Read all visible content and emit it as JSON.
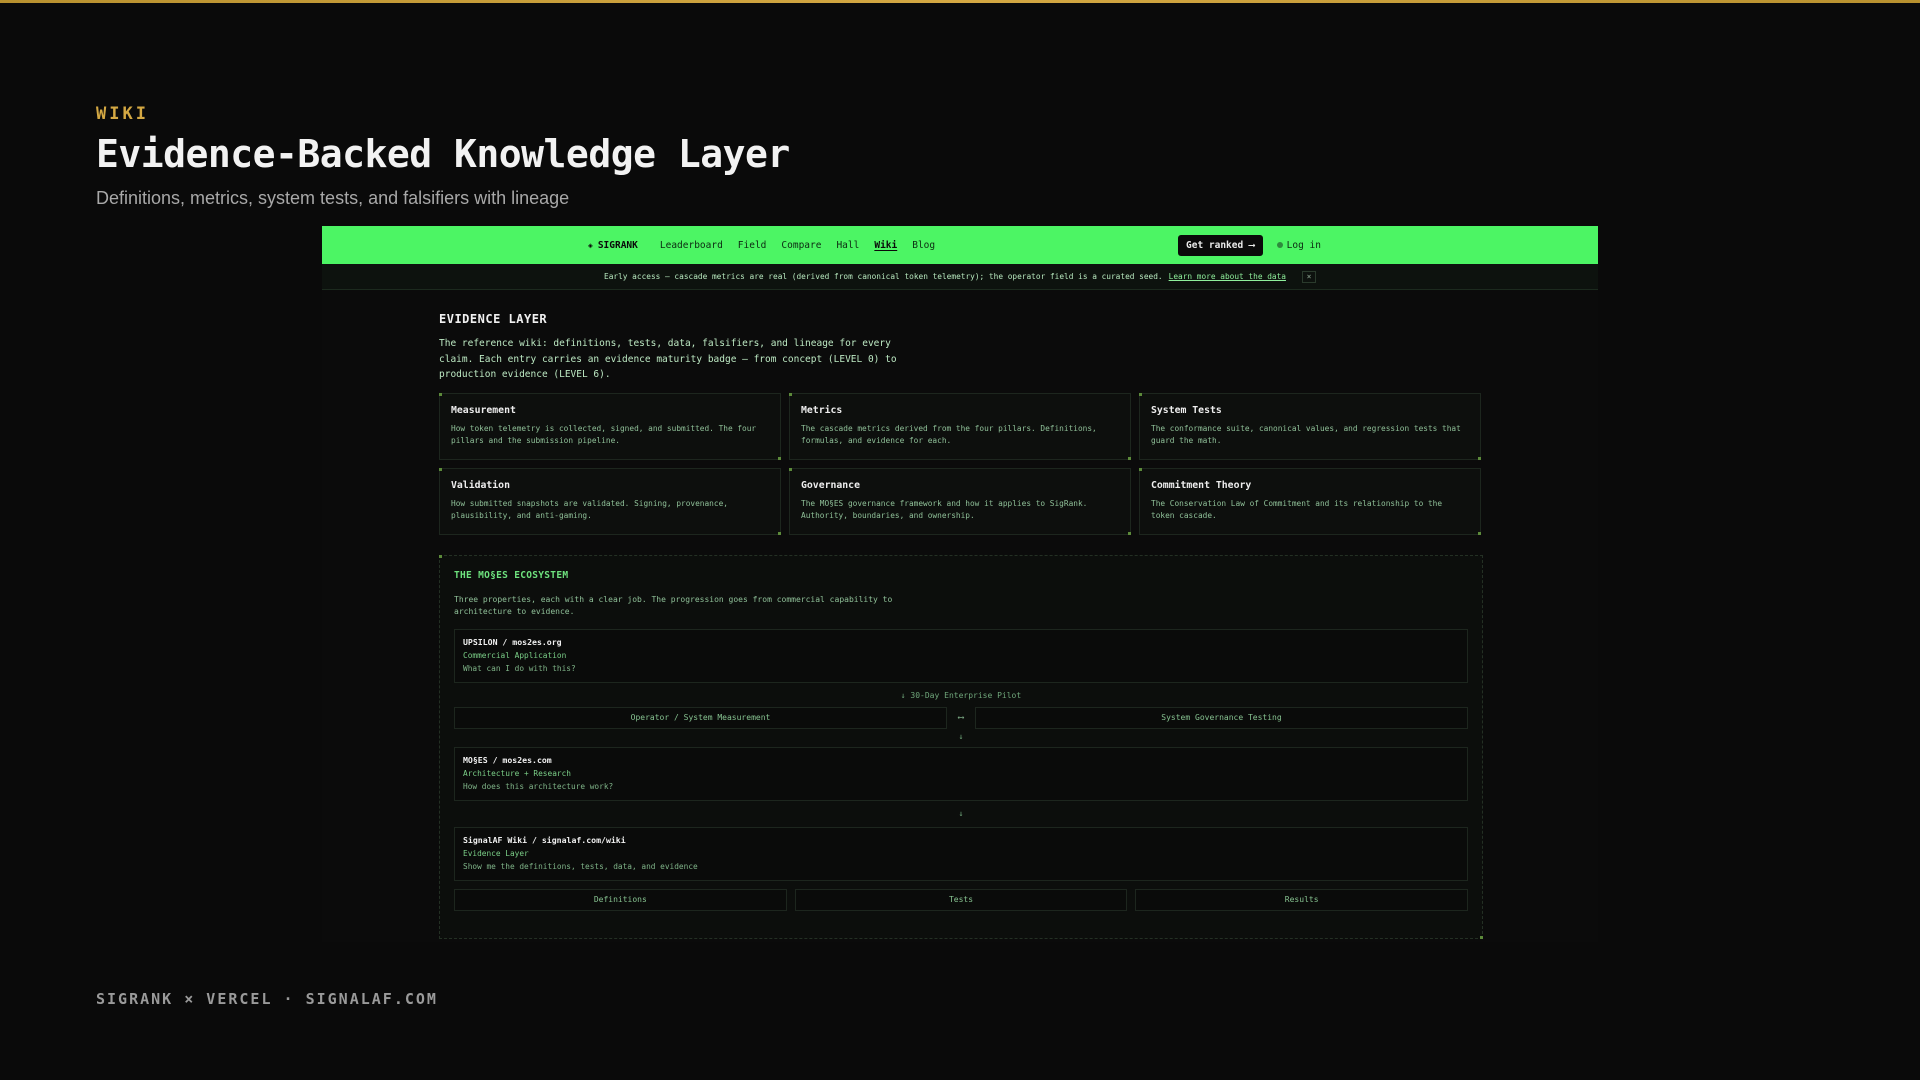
{
  "slide": {
    "eyebrow": "WIKI",
    "title": "Evidence-Backed Knowledge Layer",
    "subtitle": "Definitions, metrics, system tests, and falsifiers with lineage",
    "footer": "SIGRANK × VERCEL · SIGNALAF.COM"
  },
  "nav": {
    "brand": "SIGRANK",
    "brand_icon": "diamond-icon",
    "links": [
      "Leaderboard",
      "Field",
      "Compare",
      "Hall",
      "Wiki",
      "Blog"
    ],
    "active": "Wiki",
    "cta": "Get ranked ⟶",
    "login": "Log in"
  },
  "banner": {
    "text": "Early access — cascade metrics are real (derived from canonical token telemetry); the operator field is a curated seed.",
    "link": "Learn more about the data",
    "close": "×"
  },
  "evidence": {
    "title": "EVIDENCE LAYER",
    "description": "The reference wiki: definitions, tests, data, falsifiers, and lineage for every claim. Each entry carries an evidence maturity badge — from concept (LEVEL 0) to production evidence (LEVEL 6)."
  },
  "cards": [
    {
      "title": "Measurement",
      "desc": "How token telemetry is collected, signed, and submitted. The four pillars and the submission pipeline."
    },
    {
      "title": "Metrics",
      "desc": "The cascade metrics derived from the four pillars. Definitions, formulas, and evidence for each."
    },
    {
      "title": "System Tests",
      "desc": "The conformance suite, canonical values, and regression tests that guard the math."
    },
    {
      "title": "Validation",
      "desc": "How submitted snapshots are validated. Signing, provenance, plausibility, and anti-gaming."
    },
    {
      "title": "Governance",
      "desc": "The MO§ES governance framework and how it applies to SigRank. Authority, boundaries, and ownership."
    },
    {
      "title": "Commitment Theory",
      "desc": "The Conservation Law of Commitment and its relationship to the token cascade."
    }
  ],
  "ecosystem": {
    "title": "THE MO§ES ECOSYSTEM",
    "description": "Three properties, each with a clear job. The progression goes from commercial capability to architecture to evidence.",
    "upsilon": {
      "name": "UPSILON / mos2es.org",
      "role": "Commercial Application",
      "question": "What can I do with this?"
    },
    "pilot_label": "↓ 30-Day Enterprise Pilot",
    "pilot_left": "Operator / System Measurement",
    "pilot_sep": "⟷",
    "pilot_right": "System Governance Testing",
    "arrow": "↓",
    "moses": {
      "name": "MO§ES / mos2es.com",
      "role": "Architecture + Research",
      "question": "How does this architecture work?"
    },
    "signalaf": {
      "name": "SignalAF Wiki / signalaf.com/wiki",
      "role": "Evidence Layer",
      "question": "Show me the definitions, tests, data, and evidence"
    },
    "evidence_items": [
      "Definitions",
      "Tests",
      "Results"
    ]
  },
  "colors": {
    "accent_gold": "#d4a843",
    "nav_green": "#4cf564",
    "background": "#0a0a0a"
  }
}
